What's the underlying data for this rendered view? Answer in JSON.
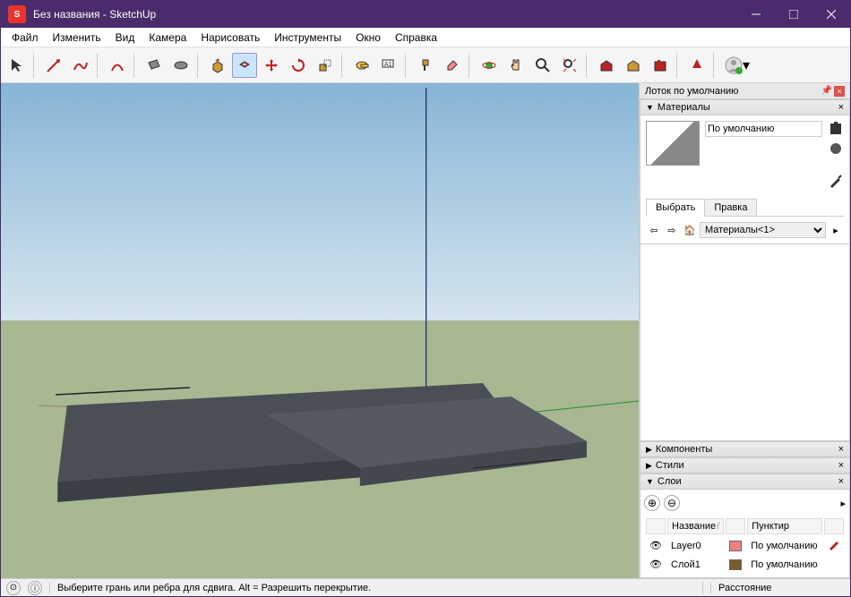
{
  "window": {
    "title": "Без названия - SketchUp"
  },
  "menu": {
    "file": "Файл",
    "edit": "Изменить",
    "view": "Вид",
    "camera": "Камера",
    "draw": "Нарисовать",
    "tools": "Инструменты",
    "window": "Окно",
    "help": "Справка"
  },
  "toolbar_icons": {
    "select": "select-arrow",
    "line": "line",
    "freehand": "freehand",
    "arc": "arc",
    "rectangle": "rectangle",
    "circle": "circle",
    "pushpull": "pushpull",
    "offset": "offset",
    "move": "move",
    "rotate": "rotate",
    "scale": "scale",
    "tape": "tape",
    "text": "text",
    "paint": "paint",
    "eraser": "eraser",
    "orbit": "orbit",
    "pan": "pan",
    "zoom": "zoom",
    "zoomextents": "zoom-extents",
    "walk": "walk",
    "warehouse": "3dwarehouse",
    "extensions": "extensions",
    "addlocation": "add-location",
    "user": "user"
  },
  "tray": {
    "title": "Лоток по умолчанию"
  },
  "materials": {
    "header": "Материалы",
    "current": "По умолчанию",
    "tabs": {
      "select": "Выбрать",
      "edit": "Правка"
    },
    "collection": "Материалы<1>"
  },
  "components": {
    "header": "Компоненты"
  },
  "styles": {
    "header": "Стили"
  },
  "layers": {
    "header": "Слои",
    "col_name": "Название",
    "col_dashes": "Пунктир",
    "rows": [
      {
        "name": "Layer0",
        "color": "#f08080",
        "dashes": "По умолчанию"
      },
      {
        "name": "Слой1",
        "color": "#7a5c2e",
        "dashes": "По умолчанию"
      }
    ]
  },
  "statusbar": {
    "msg": "Выберите грань или ребра для сдвига. Alt = Разрешить перекрытие.",
    "measure_label": "Расстояние"
  }
}
